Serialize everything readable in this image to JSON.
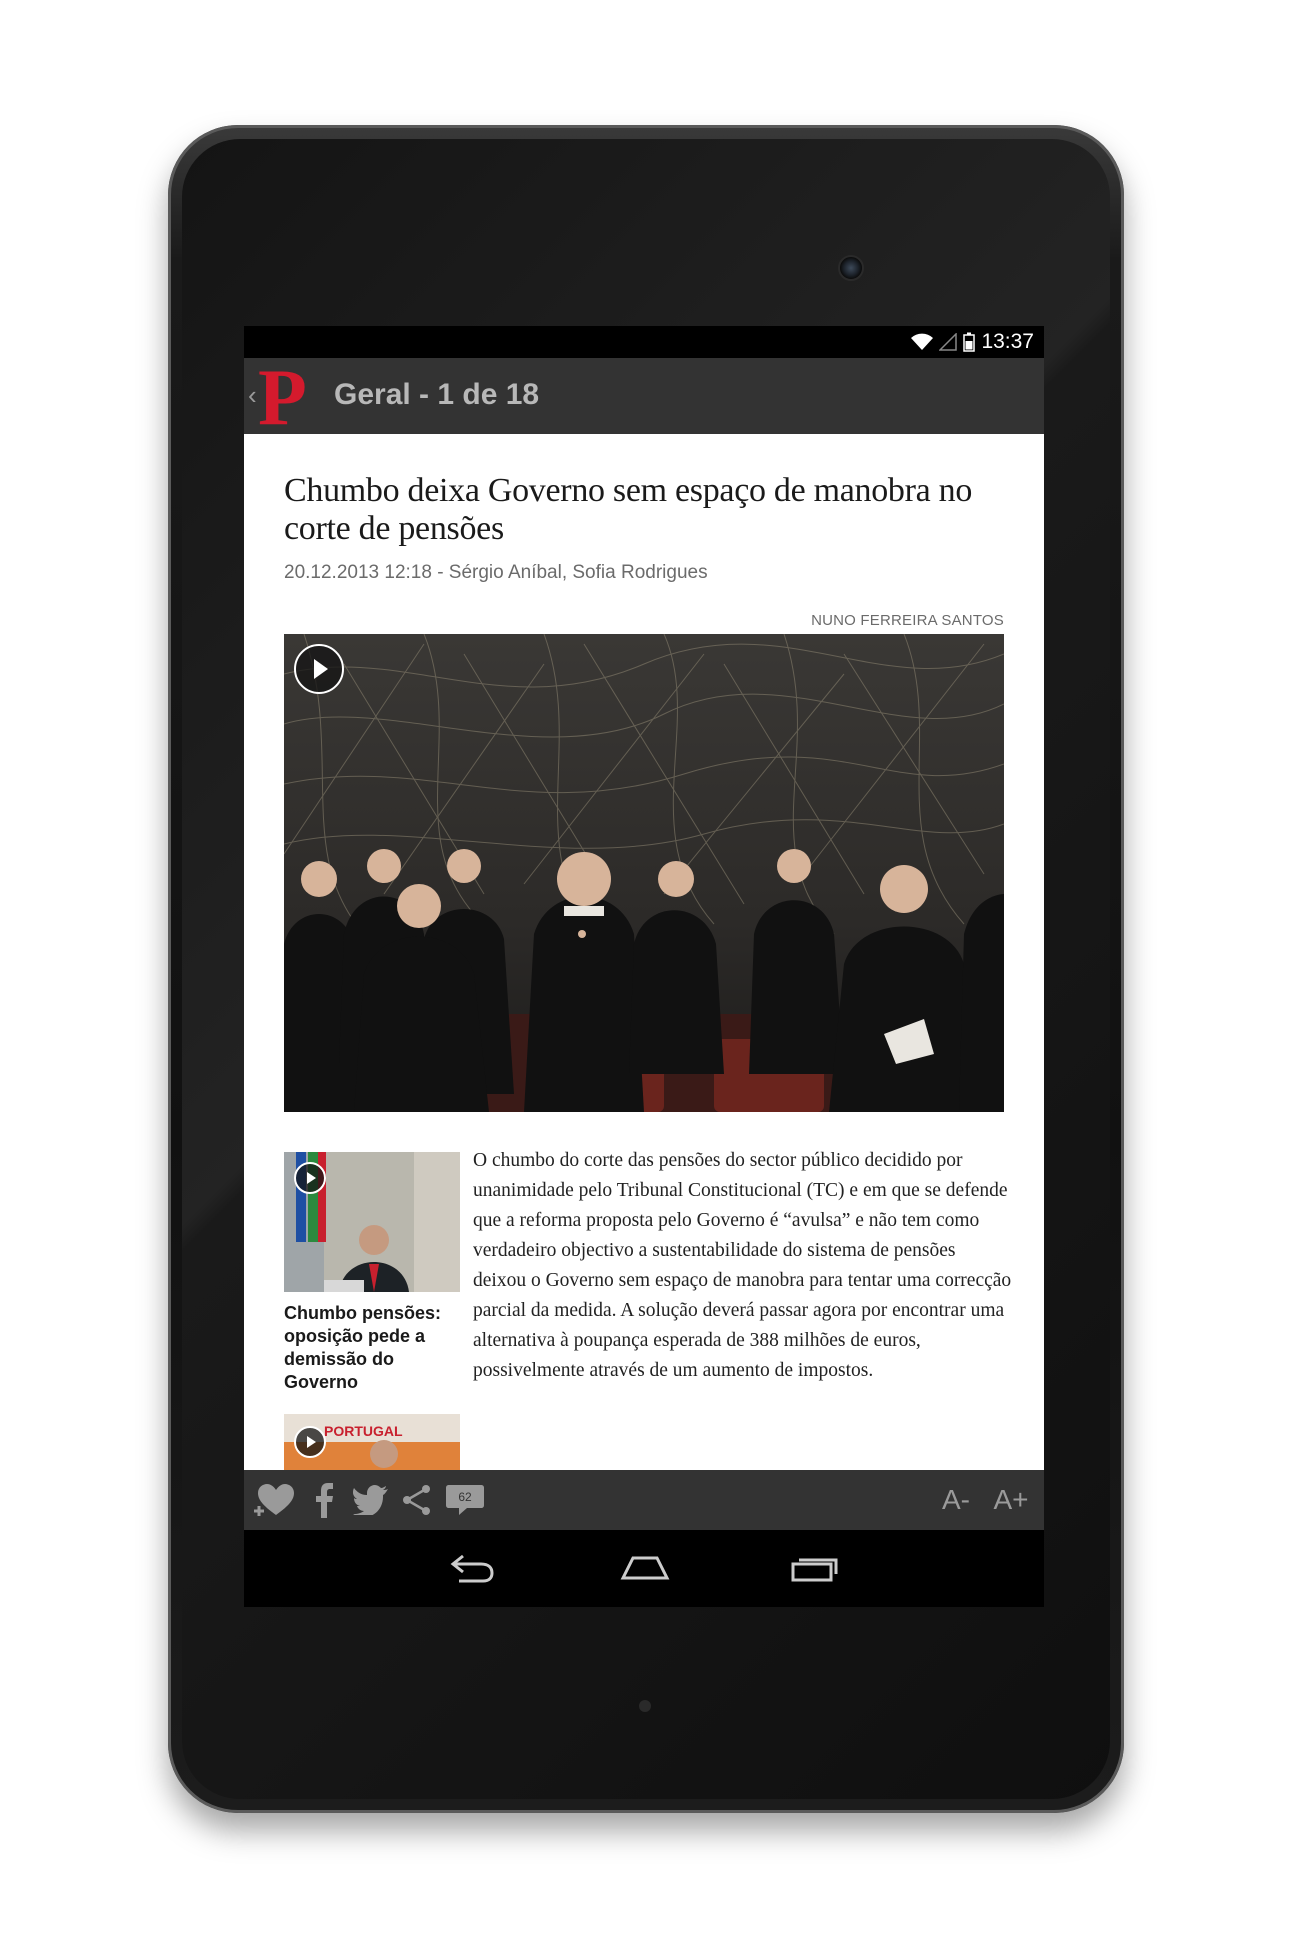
{
  "status_bar": {
    "time": "13:37"
  },
  "app_bar": {
    "back_icon": "chevron-left-icon",
    "logo": "P",
    "title": "Geral - 1 de 18"
  },
  "article": {
    "headline": "Chumbo deixa Governo sem espaço de manobra no corte de pensões",
    "byline": "20.12.2013 12:18 - Sérgio Aníbal, Sofia Rodrigues",
    "photo_credit": "NUNO FERREIRA SANTOS",
    "body": "O chumbo do corte das pensões do sector público decidido por unanimidade pelo Tribunal Constitucional (TC) e em que se defende que a reforma proposta pelo Governo é “avulsa” e não tem como verdadeiro objectivo a sustentabilidade do sistema de pensões deixou o Governo sem espaço de manobra para tentar uma correcção parcial da medida. A solução deverá passar agora por encontrar uma alternativa à poupança esperada de 388 milhões de euros, possivelmente através de um aumento de impostos."
  },
  "related": [
    {
      "title": "Chumbo pensões: oposição pede a demissão do Governo"
    },
    {
      "thumb_text": "PORTUGAL"
    }
  ],
  "action_bar": {
    "comments_count": "62",
    "font_decrease": "A-",
    "font_increase": "A+"
  },
  "colors": {
    "brand": "#d41a2d",
    "bar": "#333333",
    "icon": "#9a9a9a"
  }
}
